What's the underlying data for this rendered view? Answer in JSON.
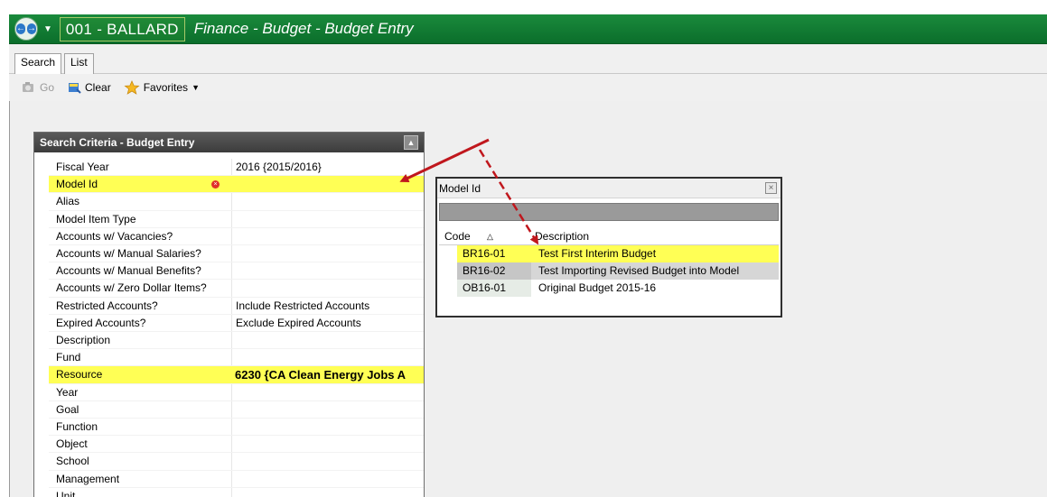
{
  "titlebar": {
    "district": "001 - BALLARD",
    "page_title": "Finance - Budget - Budget Entry"
  },
  "tabs": [
    {
      "label": "Search",
      "active": true
    },
    {
      "label": "List",
      "active": false
    }
  ],
  "toolbar": {
    "go_label": "Go",
    "clear_label": "Clear",
    "favorites_label": "Favorites"
  },
  "criteria": {
    "title": "Search Criteria - Budget Entry",
    "rows": [
      {
        "label": "Fiscal Year",
        "value": "2016 {2015/2016}"
      },
      {
        "label": "Model Id",
        "value": ""
      },
      {
        "label": "Alias",
        "value": ""
      },
      {
        "label": "Model Item Type",
        "value": ""
      },
      {
        "label": "Accounts w/ Vacancies?",
        "value": ""
      },
      {
        "label": "Accounts w/ Manual Salaries?",
        "value": ""
      },
      {
        "label": "Accounts w/ Manual Benefits?",
        "value": ""
      },
      {
        "label": "Accounts w/ Zero Dollar Items?",
        "value": ""
      },
      {
        "label": "Restricted Accounts?",
        "value": "Include Restricted Accounts"
      },
      {
        "label": "Expired Accounts?",
        "value": "Exclude Expired Accounts"
      },
      {
        "label": "Description",
        "value": ""
      },
      {
        "label": "Fund",
        "value": ""
      },
      {
        "label": "Resource",
        "value": "6230 {CA Clean Energy Jobs A"
      },
      {
        "label": "Year",
        "value": ""
      },
      {
        "label": "Goal",
        "value": ""
      },
      {
        "label": "Function",
        "value": ""
      },
      {
        "label": "Object",
        "value": ""
      },
      {
        "label": "School",
        "value": ""
      },
      {
        "label": "Management",
        "value": ""
      },
      {
        "label": "Unit",
        "value": ""
      }
    ]
  },
  "lookup": {
    "title": "Model Id",
    "col_code": "Code",
    "col_desc": "Description",
    "rows": [
      {
        "code": "BR16-01",
        "desc": "Test First Interim Budget"
      },
      {
        "code": "BR16-02",
        "desc": "Test Importing Revised Budget into Model"
      },
      {
        "code": "OB16-01",
        "desc": "Original Budget 2015-16"
      }
    ]
  },
  "colors": {
    "title_green": "#0b6e2b",
    "highlight_yellow": "#ffff55",
    "arrow_red": "#c0171d"
  },
  "icons": [
    "back-arrow-icon",
    "forward-arrow-icon",
    "go-icon",
    "clear-icon",
    "favorites-star-icon",
    "collapse-icon",
    "close-icon",
    "required-icon",
    "sort-ascending-icon"
  ]
}
